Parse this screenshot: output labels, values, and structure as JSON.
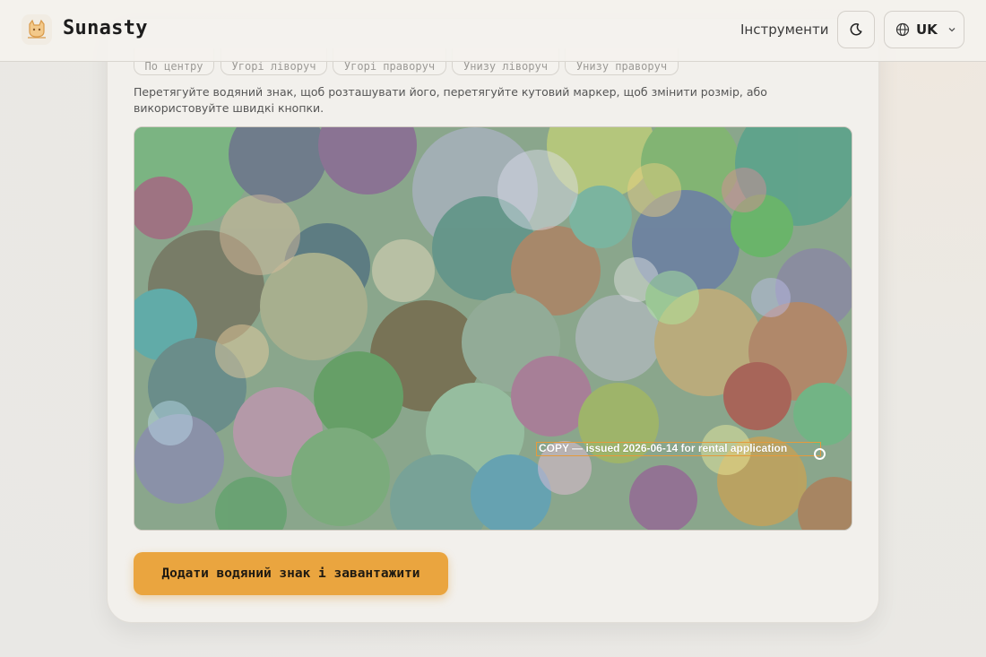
{
  "header": {
    "brand": "Sunasty",
    "nav_tools": "Інструменти",
    "language": "UK"
  },
  "positions": [
    {
      "label": "По центру"
    },
    {
      "label": "Угорі ліворуч"
    },
    {
      "label": "Угорі праворуч"
    },
    {
      "label": "Унизу ліворуч"
    },
    {
      "label": "Унизу праворуч"
    }
  ],
  "hint": "Перетягуйте водяний знак, щоб розташувати його, перетягуйте кутовий маркер, щоб змінити розмір, або використовуйте швидкі кнопки.",
  "watermark": {
    "text": "COPY — issued 2026-06-14 for rental application"
  },
  "submit_label": "Додати водяний знак і завантажити",
  "colors": {
    "accent": "#eaa53f",
    "watermark_border": "#e59a3c"
  }
}
